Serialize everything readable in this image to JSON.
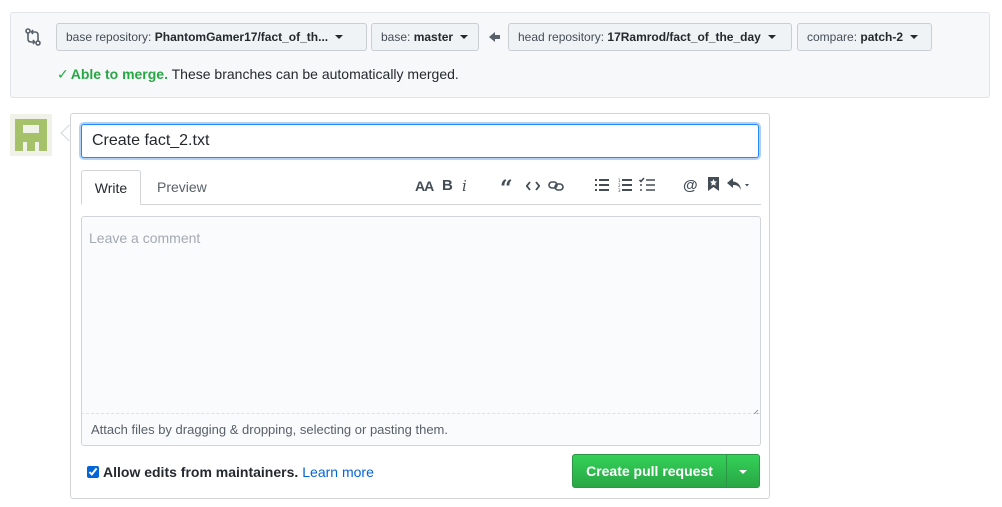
{
  "compare": {
    "base_repo": {
      "label": "base repository:",
      "value": "PhantomGamer17/fact_of_th..."
    },
    "base": {
      "label": "base:",
      "value": "master"
    },
    "head_repo": {
      "label": "head repository:",
      "value": "17Ramrod/fact_of_the_day"
    },
    "compare": {
      "label": "compare:",
      "value": "patch-2"
    },
    "merge_check": "✓",
    "merge_ok": "Able to merge.",
    "merge_detail": "These branches can be automatically merged."
  },
  "composer": {
    "title_value": "Create fact_2.txt",
    "tabs": [
      {
        "label": "Write"
      },
      {
        "label": "Preview"
      }
    ],
    "toolbar": {
      "heading": "AA",
      "bold": "B",
      "italic": "i",
      "quote": "“"
    },
    "comment_placeholder": "Leave a comment",
    "attach_text": "Attach files by dragging & dropping, selecting or pasting them."
  },
  "footer": {
    "allow_edits_label": "Allow edits from maintainers.",
    "learn_more": "Learn more",
    "allow_edits_checked": true,
    "create_button": "Create pull request"
  },
  "colors": {
    "accent": "#0366d6",
    "success": "#28a745",
    "focus_border": "#2188ff"
  }
}
